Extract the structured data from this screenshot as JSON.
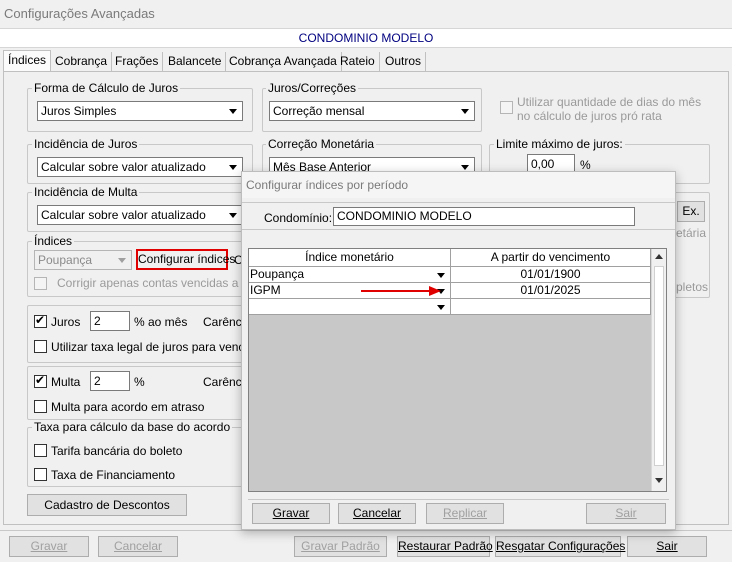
{
  "window_title": "Configurações Avançadas",
  "header_title": "CONDOMINIO MODELO",
  "tabs": [
    "Índices",
    "Cobrança",
    "Frações",
    "Balancete",
    "Cobrança Avançada",
    "Rateio",
    "Outros"
  ],
  "forma_calculo": {
    "label": "Forma de Cálculo de Juros",
    "value": "Juros Simples"
  },
  "juros_correcoes": {
    "label": "Juros/Correções",
    "value": "Correção mensal"
  },
  "utilizar_qtd_dias": {
    "line1": "Utilizar quantidade de dias do mês",
    "line2": "no cálculo de juros pró rata"
  },
  "incidencia_juros": {
    "label": "Incidência de Juros",
    "value": "Calcular sobre valor atualizado"
  },
  "correcao_monetaria": {
    "label": "Correção Monetária",
    "value": "Mês Base Anterior"
  },
  "limite_juros": {
    "label": "Limite máximo de juros:",
    "value": "0,00",
    "unit": "%"
  },
  "incidencia_multa": {
    "label": "Incidência de Multa",
    "value": "Calcular sobre valor atualizado"
  },
  "indices": {
    "label": "Índices",
    "value": "Poupança",
    "configurar_button": "Configurar índices",
    "trailing_letter": "C",
    "corrigir_label": "Corrigir apenas contas vencidas a mais"
  },
  "juros": {
    "label": "Juros",
    "value": "2",
    "unit": "% ao mês",
    "carencia": "Carência",
    "taxa_legal": "Utilizar taxa legal de juros para vencime"
  },
  "multa": {
    "label": "Multa",
    "value": "2",
    "unit": "%",
    "carencia": "Carência",
    "acordo": "Multa para acordo em atraso"
  },
  "taxa_base": {
    "label": "Taxa para cálculo da base do acordo",
    "tarifa": "Tarifa bancária do boleto",
    "financiamento": "Taxa de Financiamento"
  },
  "cadastro_descontos": "Cadastro de Descontos",
  "right_partial": {
    "ex_button": "Ex.",
    "etaria": "etária",
    "pletos": "pletos"
  },
  "footer": {
    "gravar": "Gravar",
    "cancelar": "Cancelar",
    "gravar_padrao": "Gravar Padrão",
    "restaurar_padrao": "Restaurar Padrão",
    "resgatar": "Resgatar Configurações",
    "sair": "Sair"
  },
  "dialog": {
    "title": "Configurar índices por período",
    "condominio_label": "Condomínio:",
    "condominio_value": "CONDOMINIO MODELO",
    "grid": {
      "headers": [
        "Índice monetário",
        "A partir do vencimento"
      ],
      "rows": [
        {
          "indice": "Poupança",
          "data": "01/01/1900"
        },
        {
          "indice": "IGPM",
          "data": "01/01/2025"
        },
        {
          "indice": "",
          "data": ""
        }
      ]
    },
    "buttons": {
      "gravar": "Gravar",
      "cancelar": "Cancelar",
      "replicar": "Replicar",
      "sair": "Sair"
    }
  },
  "colors": {
    "highlight": "#e00000",
    "header_text": "#000080",
    "arrow": "#e00000"
  }
}
